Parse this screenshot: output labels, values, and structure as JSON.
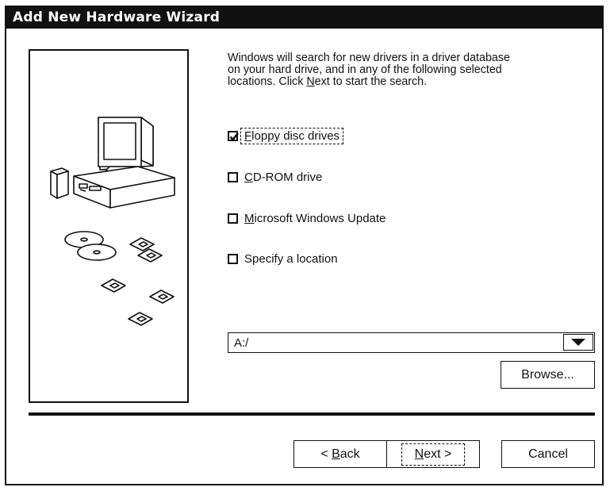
{
  "window": {
    "title": "Add New Hardware Wizard"
  },
  "intro": {
    "line1": "Windows will search for new drivers in a driver database",
    "line2": "on your hard drive, and in any of the following selected",
    "line3_pre": "locations. Click ",
    "line3_key": "N",
    "line3_rest": "ext",
    "line3_post": " to start the search."
  },
  "options": [
    {
      "key": "F",
      "rest": "loppy disc drives",
      "checked": true,
      "focused": true
    },
    {
      "key": "C",
      "rest": "D-ROM drive",
      "checked": false
    },
    {
      "key": "M",
      "rest": "icrosoft Windows Update",
      "checked": false
    },
    {
      "key": "",
      "rest": "Specify a location",
      "checked": false
    }
  ],
  "location": {
    "value": "A:/",
    "arrow_icon": "down-triangle-icon"
  },
  "buttons": {
    "browse": "Browse...",
    "back_pre": "< ",
    "back_key": "B",
    "back_rest": "ack",
    "next_key": "N",
    "next_rest": "ext >",
    "cancel": "Cancel"
  },
  "illustration": {
    "icons": [
      "computer-icon",
      "cd-discs-icon",
      "floppy-disks-icon"
    ]
  },
  "colors": {
    "ink": "#111111",
    "background": "#ffffff"
  }
}
